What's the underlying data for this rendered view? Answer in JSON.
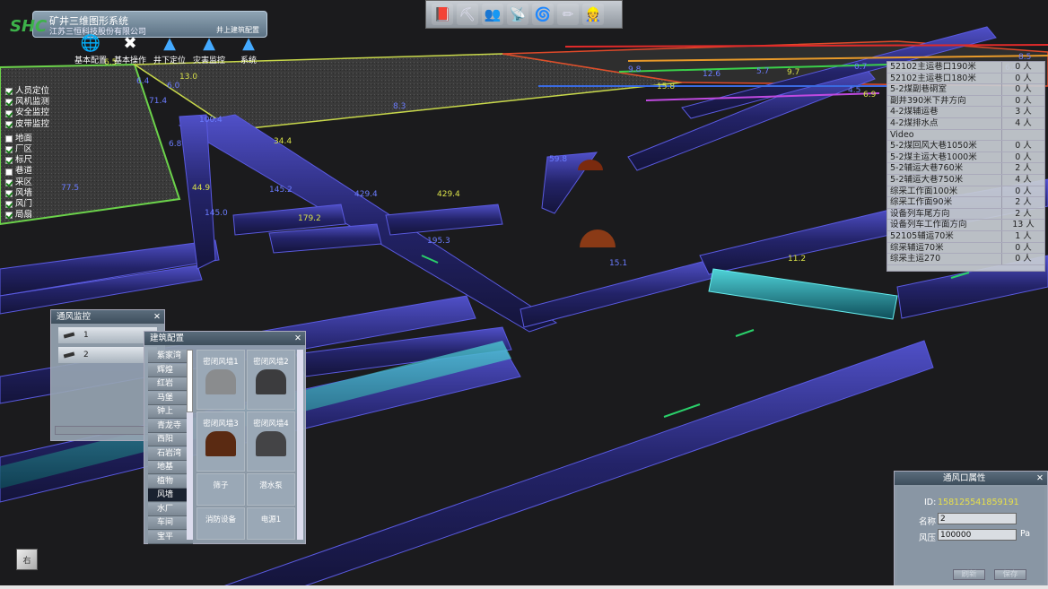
{
  "app": {
    "title": "矿井三维图形系统",
    "company": "江苏三恒科技股份有限公司",
    "subtitle": "井上建筑配置",
    "logo": "SHC"
  },
  "main_menu": [
    {
      "label": "基本配置",
      "icon": "globe-icon"
    },
    {
      "label": "基本操作",
      "icon": "tools-icon"
    },
    {
      "label": "井下定位",
      "icon": "person-pin-icon"
    },
    {
      "label": "灾害监控",
      "icon": "hazard-icon"
    },
    {
      "label": "系统",
      "icon": "system-icon"
    }
  ],
  "top_toolbar": [
    {
      "icon": "book-icon",
      "glyph": "📕"
    },
    {
      "icon": "miner-icon",
      "glyph": "⛏"
    },
    {
      "icon": "personnel-icon",
      "glyph": "👥"
    },
    {
      "icon": "sensor-icon",
      "glyph": "📡"
    },
    {
      "icon": "fan-icon",
      "glyph": "🌀"
    },
    {
      "icon": "pencil-icon",
      "glyph": "✏"
    },
    {
      "icon": "user-settings-icon",
      "glyph": "👷"
    }
  ],
  "layers": {
    "group1": [
      {
        "label": "人员定位",
        "checked": true
      },
      {
        "label": "风机监测",
        "checked": true
      },
      {
        "label": "安全监控",
        "checked": true
      },
      {
        "label": "皮带监控",
        "checked": true
      }
    ],
    "group2": [
      {
        "label": "地面",
        "checked": false
      },
      {
        "label": "厂区",
        "checked": true
      },
      {
        "label": "标尺",
        "checked": true
      },
      {
        "label": "巷道",
        "checked": false
      },
      {
        "label": "采区",
        "checked": true
      },
      {
        "label": "风墙",
        "checked": true
      },
      {
        "label": "风门",
        "checked": true
      },
      {
        "label": "局扇",
        "checked": true
      }
    ]
  },
  "stats": [
    {
      "name": "52102主运巷口190米",
      "value": "0 人"
    },
    {
      "name": "52102主运巷口180米",
      "value": "0 人"
    },
    {
      "name": "5-2煤副巷硐室",
      "value": "0 人"
    },
    {
      "name": "副井390米下井方向",
      "value": "0 人"
    },
    {
      "name": "4-2煤辅运巷",
      "value": "3 人"
    },
    {
      "name": "4-2煤排水点",
      "value": "4 人"
    },
    {
      "name": "Video",
      "value": ""
    },
    {
      "name": "5-2煤回风大巷1050米",
      "value": "0 人"
    },
    {
      "name": "5-2煤主运大巷1000米",
      "value": "0 人"
    },
    {
      "name": "5-2辅运大巷760米",
      "value": "2 人"
    },
    {
      "name": "5-2辅运大巷750米",
      "value": "4 人"
    },
    {
      "name": "综采工作面100米",
      "value": "0 人"
    },
    {
      "name": "综采工作面90米",
      "value": "2 人"
    },
    {
      "name": "设备列车尾方向",
      "value": "2 人"
    },
    {
      "name": "设备列车工作面方向",
      "value": "13 人"
    },
    {
      "name": "52105辅运70米",
      "value": "1 人"
    },
    {
      "name": "综采辅运70米",
      "value": "0 人"
    },
    {
      "name": "综采主运270",
      "value": "0 人"
    }
  ],
  "vent_window": {
    "title": "通风监控",
    "items": [
      "1",
      "2"
    ]
  },
  "build_window": {
    "title": "建筑配置",
    "categories": [
      "紫家湾",
      "辉煌",
      "红岩",
      "马堡",
      "钟上",
      "青龙寺",
      "西阳",
      "石岩湾",
      "地基",
      "植物",
      "风墙",
      "水厂",
      "车间",
      "宝平"
    ],
    "selected": "风墙",
    "cells": [
      {
        "label": "密闭风墙1",
        "color": "#8a8c8e"
      },
      {
        "label": "密闭风墙2",
        "color": "#3c3c3e"
      },
      {
        "label": "密闭风墙3",
        "color": "#5a2a12"
      },
      {
        "label": "密闭风墙4",
        "color": "#444446"
      },
      {
        "label": "筛子",
        "color": ""
      },
      {
        "label": "潜水泵",
        "color": ""
      },
      {
        "label": "消防设备",
        "color": ""
      },
      {
        "label": "电源1",
        "color": ""
      }
    ]
  },
  "prop_window": {
    "title": "通风口属性",
    "id_label": "ID:",
    "id_value": "158125541859191",
    "name_label": "名称",
    "name_value": "2",
    "pressure_label": "风压",
    "pressure_value": "100000",
    "pressure_unit": "Pa",
    "btn_refresh": "刷新",
    "btn_save": "保存"
  },
  "scene_labels": [
    "6.5",
    "6.4",
    "6.0",
    "13.0",
    "71.4",
    "100.4",
    "34.4",
    "6.8",
    "77.5",
    "44.9",
    "145.2",
    "429.4",
    "429.4",
    "59.8",
    "145.0",
    "179.2",
    "195.3",
    "15.1",
    "11.2",
    "8.3",
    "9.8",
    "15.8",
    "12.6",
    "5.7",
    "9.7",
    "0.7",
    "4.5",
    "6.9",
    "8.5",
    "6.5"
  ],
  "colors": {
    "tunnel": "#2a2a7a",
    "tunnel_edge": "#4a4ad0",
    "vent": "#2aa8b0",
    "accent_green": "#3db24a",
    "label_blue": "#6b7cff"
  },
  "cube_label": "右"
}
